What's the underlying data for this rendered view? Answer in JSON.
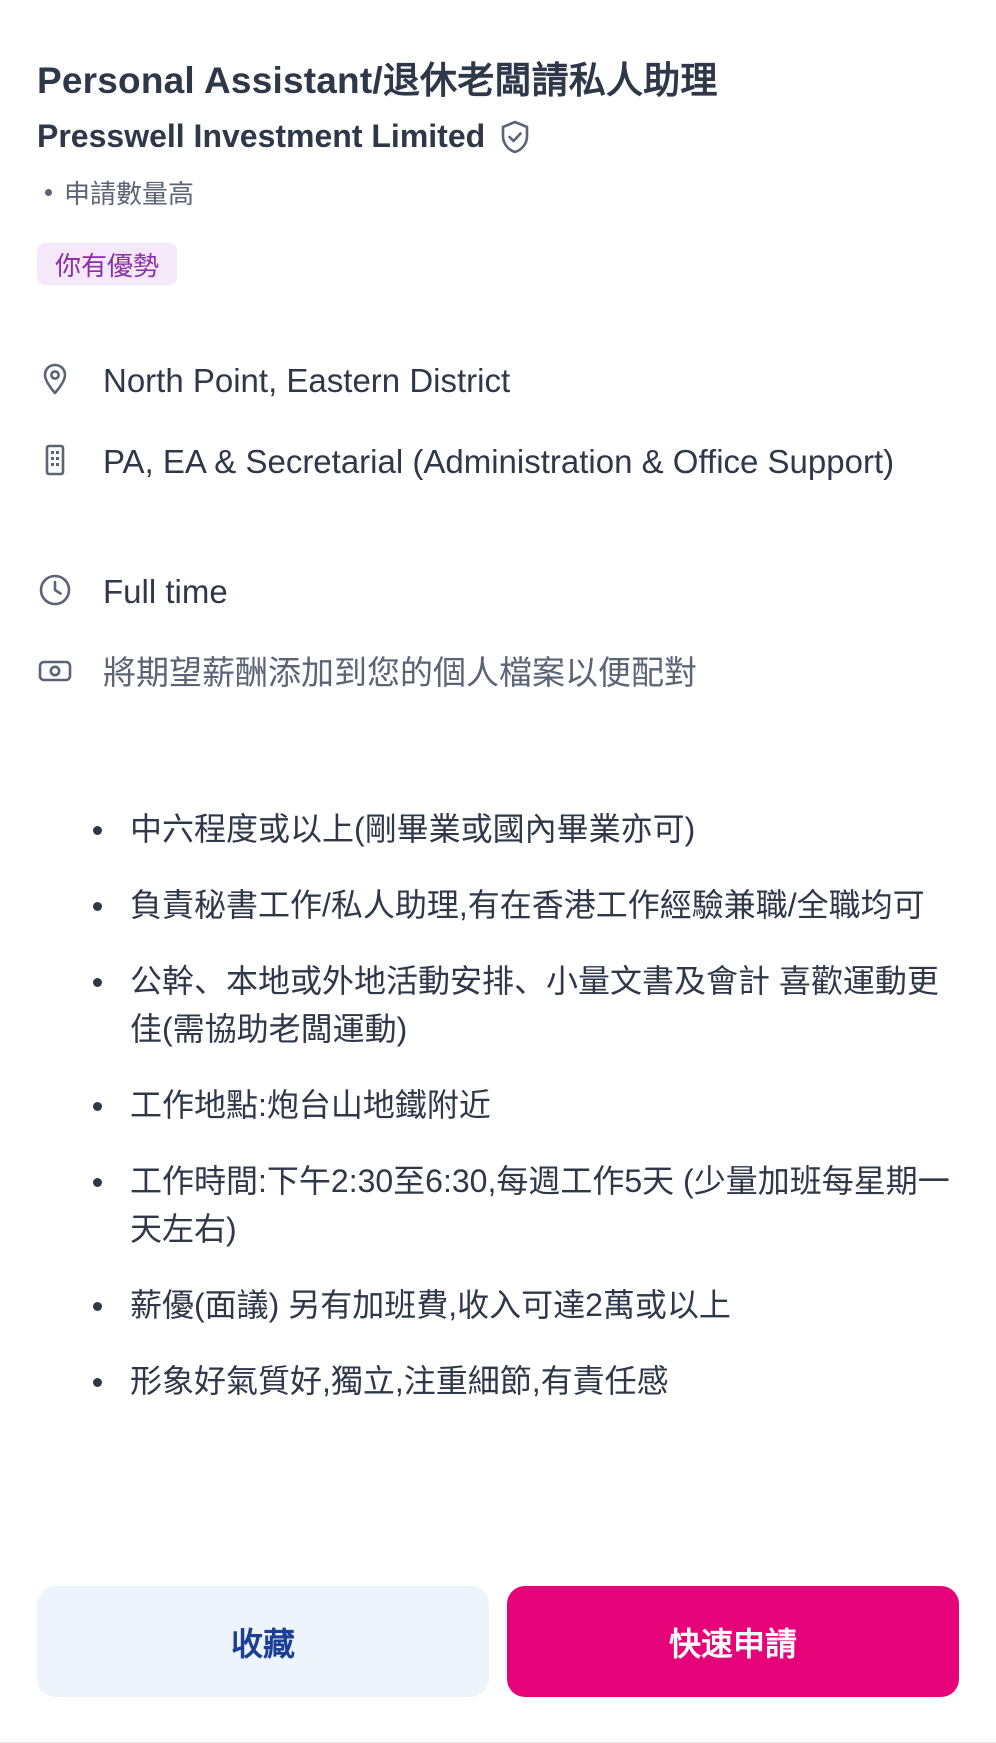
{
  "job": {
    "title": "Personal Assistant/退休老闆請私人助理",
    "company": "Presswell Investment Limited",
    "application_volume": "申請數量高",
    "advantage_badge": "你有優勢"
  },
  "details": {
    "location": "North Point, Eastern District",
    "category": "PA, EA & Secretarial (Administration & Office Support)",
    "work_type": "Full time",
    "salary_prompt": "將期望薪酬添加到您的個人檔案以便配對"
  },
  "description": {
    "items": [
      "中六程度或以上(剛畢業或國內畢業亦可)",
      "負責秘書工作/私人助理,有在香港工作經驗兼職/全職均可",
      "公幹、本地或外地活動安排、小量文書及會計 喜歡運動更佳(需協助老闆運動)",
      "工作地點:炮台山地鐵附近",
      "工作時間:下午2:30至6:30,每週工作5天 (少量加班每星期一天左右)",
      "薪優(面議) 另有加班費,收入可達2萬或以上",
      "形象好氣質好,獨立,注重細節,有責任感"
    ]
  },
  "actions": {
    "save_label": "收藏",
    "quick_apply_label": "快速申請"
  },
  "colors": {
    "accent": "#e60278",
    "save_button_bg": "#eef4fc",
    "save_button_text": "#1c3f94",
    "badge_bg": "#f5e8fb",
    "badge_text": "#8a2ea8"
  },
  "icons": {
    "verified": "shield-check-icon",
    "location": "map-pin-icon",
    "category": "building-icon",
    "work_type": "clock-icon",
    "salary": "money-icon"
  }
}
